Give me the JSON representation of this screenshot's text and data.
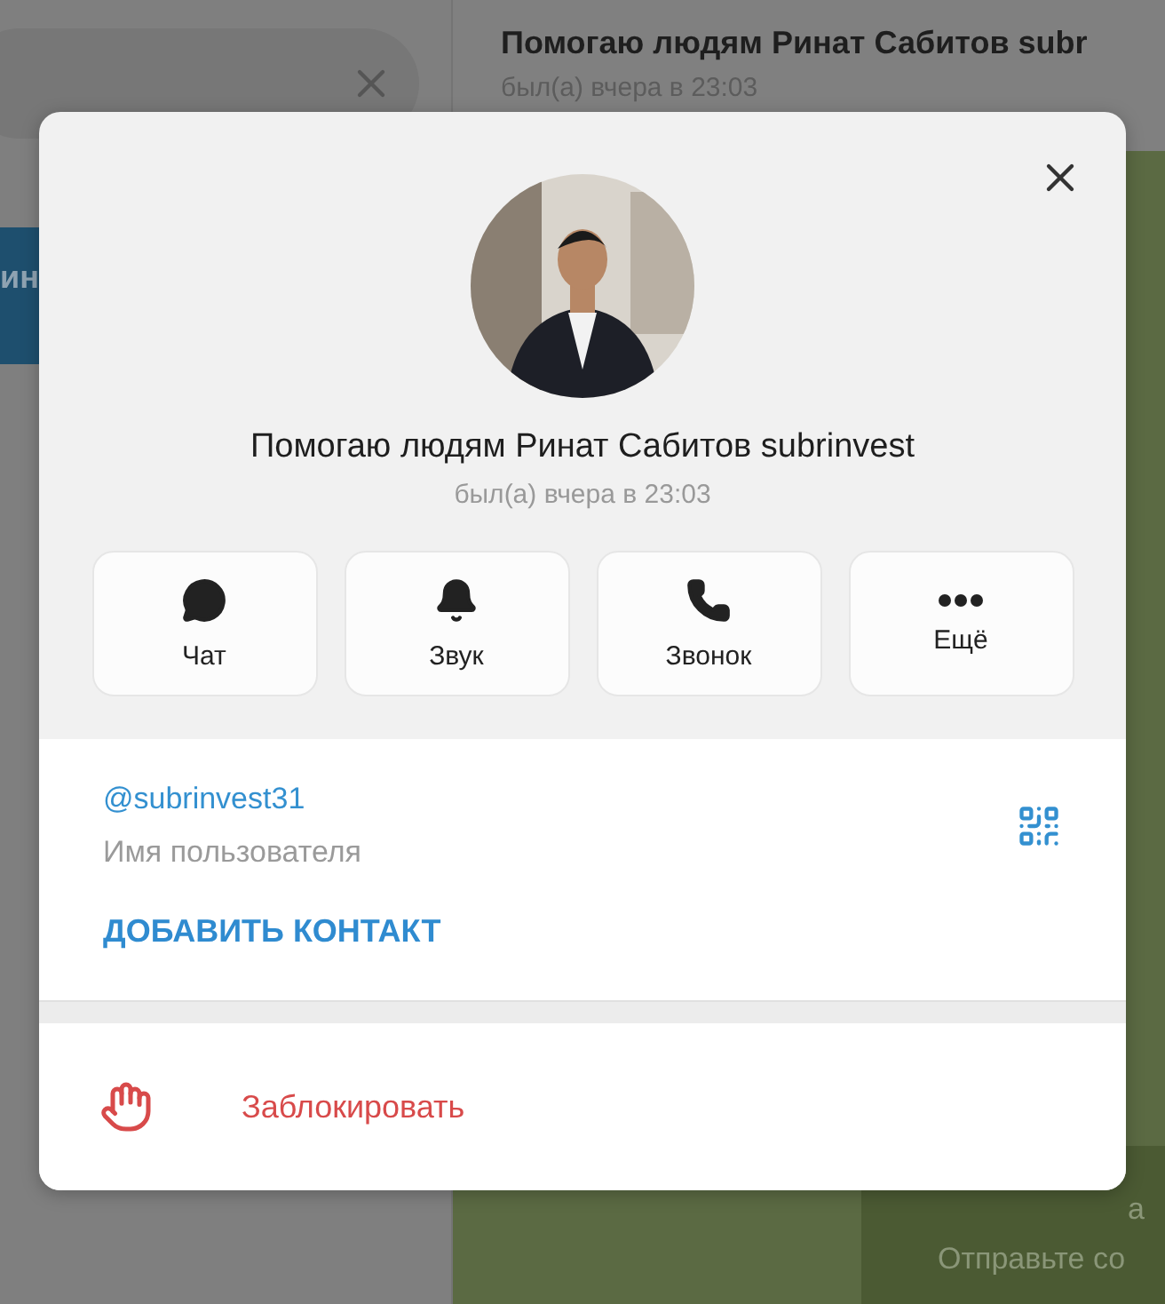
{
  "sidebar": {
    "selected_chat_fragment": "ин"
  },
  "chat_header": {
    "title": "Помогаю людям Ринат Сабитов subr",
    "status": "был(а) вчера в 23:03"
  },
  "chat_footer": {
    "line_1": "а",
    "line_2": "Отправьте со"
  },
  "profile": {
    "name": "Помогаю людям Ринат Сабитов subrinvest",
    "status": "был(а) вчера в 23:03",
    "actions": [
      {
        "kind": "chat",
        "label": "Чат"
      },
      {
        "kind": "sound",
        "label": "Звук"
      },
      {
        "kind": "call",
        "label": "Звонок"
      },
      {
        "kind": "more",
        "label": "Ещё"
      }
    ],
    "username": "@subrinvest31",
    "username_caption": "Имя пользователя",
    "add_contact": "ДОБАВИТЬ КОНТАКТ",
    "block": "Заблокировать"
  }
}
